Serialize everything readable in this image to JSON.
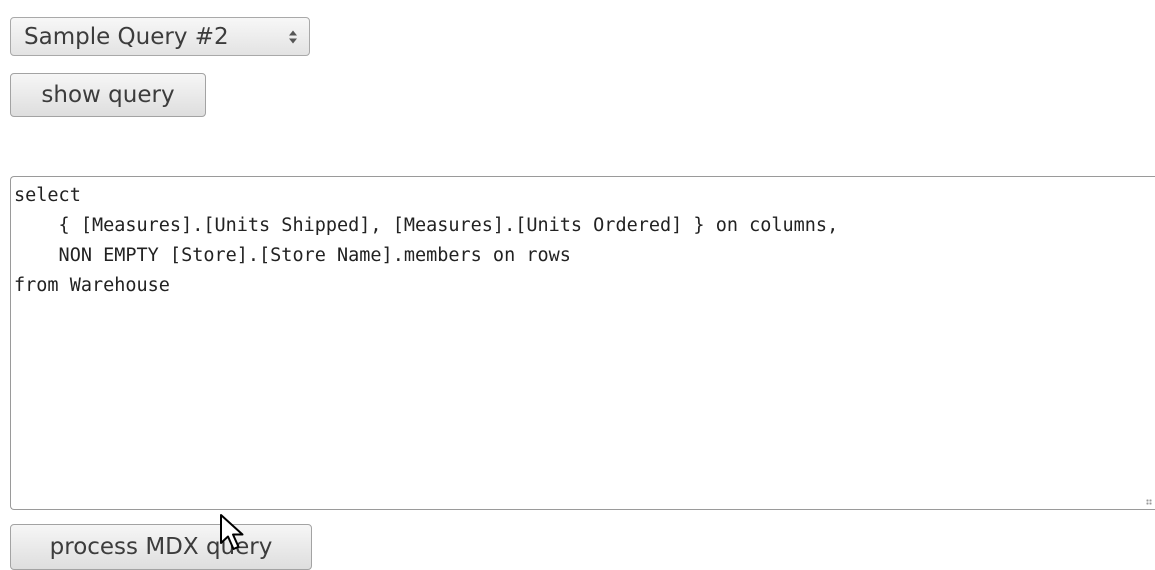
{
  "query_select": {
    "selected": "Sample Query #2"
  },
  "show_query_button": {
    "label": "show query"
  },
  "query_editor": {
    "value": "select\n    { [Measures].[Units Shipped], [Measures].[Units Ordered] } on columns,\n    NON EMPTY [Store].[Store Name].members on rows\nfrom Warehouse"
  },
  "process_button": {
    "label": "process MDX query"
  },
  "icons": {
    "select_arrows": "updown-arrows-icon",
    "cursor": "mouse-pointer-icon",
    "grip": "resize-grip-icon"
  }
}
